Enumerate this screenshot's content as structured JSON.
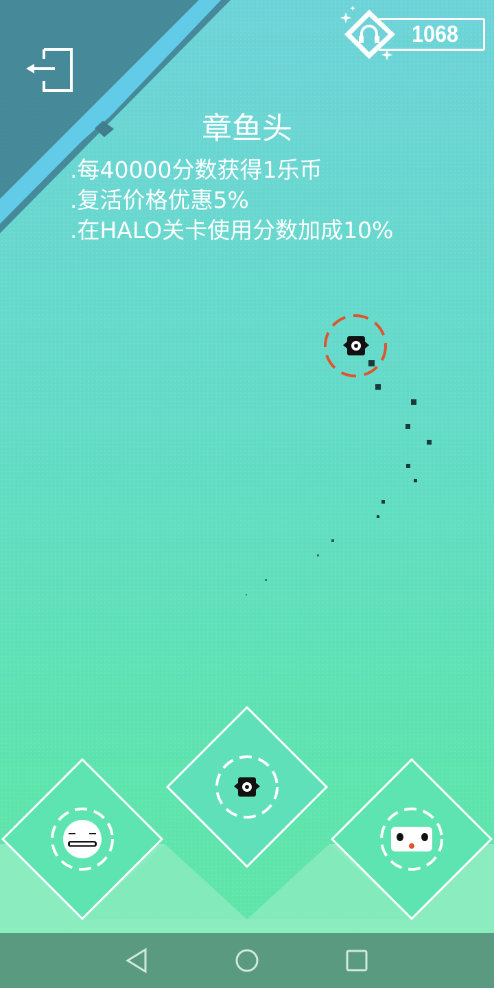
{
  "header": {
    "exit_icon": "exit-icon",
    "currency_icon": "headphones-icon",
    "coins": "1068"
  },
  "skin": {
    "name": "章鱼头",
    "perks": [
      ".每40000分数获得1乐币",
      ".复活价格优惠5%",
      ".在HALO关卡使用分数加成10%"
    ]
  },
  "selector": {
    "slots": [
      {
        "name": "smiling-face-character",
        "selected": false
      },
      {
        "name": "octopus-head-character",
        "selected": true
      },
      {
        "name": "cat-face-character",
        "selected": false
      }
    ]
  },
  "navbar": {
    "back_icon": "back-triangle-icon",
    "home_icon": "home-circle-icon",
    "recent_icon": "recent-square-icon"
  },
  "colors": {
    "sky_top": "#6ed3d8",
    "sky_bottom": "#60e6a8",
    "corner_band": "#3f7d8f",
    "stripe": "#62cbe8",
    "target_ring": "#e0532f",
    "character": "#111111",
    "navbar": "#5a9a80"
  }
}
